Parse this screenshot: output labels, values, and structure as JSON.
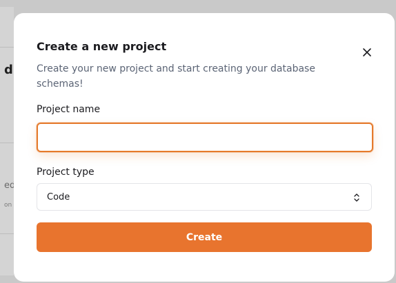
{
  "background": {
    "heading_fragment": "d",
    "text_fragment": "ed",
    "small_fragment": "on"
  },
  "modal": {
    "title": "Create a new project",
    "subtitle": "Create your new project and start creating your database schemas!",
    "close_icon": "close-icon",
    "project_name": {
      "label": "Project name",
      "value": "",
      "placeholder": ""
    },
    "project_type": {
      "label": "Project type",
      "selected": "Code",
      "icon": "chevron-up-down-icon"
    },
    "create_label": "Create"
  },
  "colors": {
    "accent": "#e8742e",
    "focus_ring": "#e57a2c",
    "subtitle_text": "#5b6475"
  }
}
